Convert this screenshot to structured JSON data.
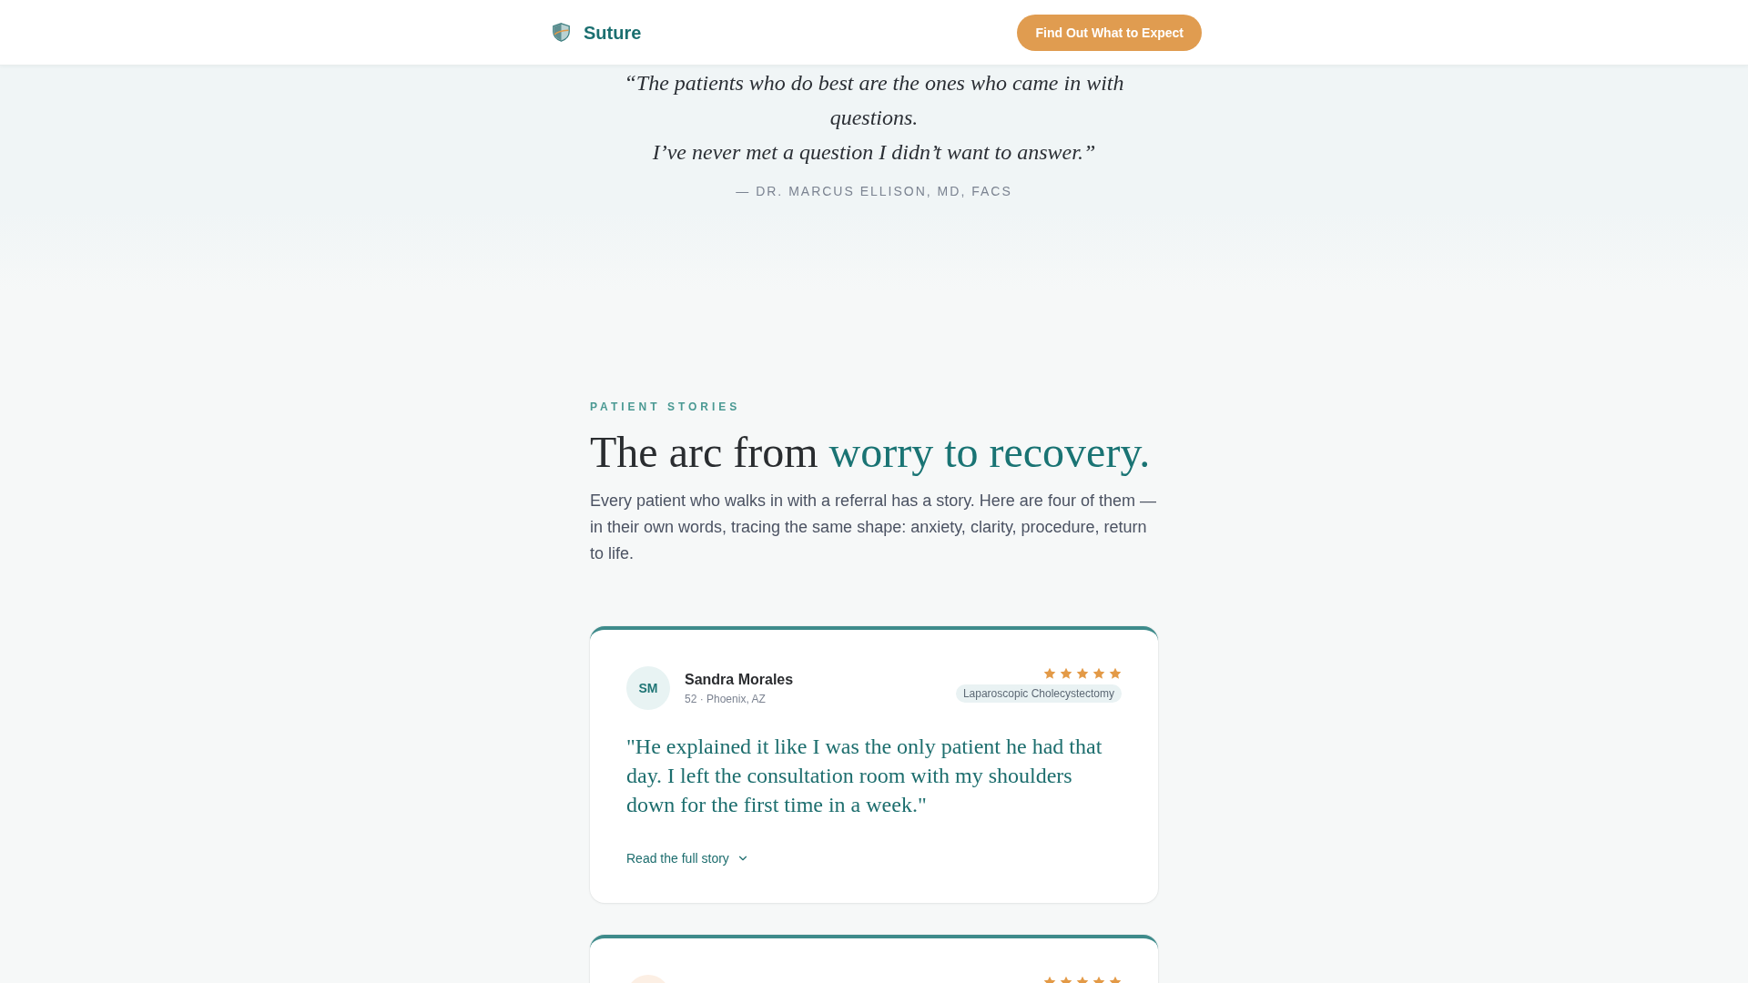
{
  "header": {
    "brand": "Suture",
    "cta": "Find Out What to Expect"
  },
  "quote": {
    "lines": [
      "“The patients who do best are the ones who came in with questions.",
      "I’ve never met a question I didn’t want to answer.”"
    ],
    "attribution": "— DR. MARCUS ELLISON, MD, FACS"
  },
  "stories_section": {
    "eyebrow": "PATIENT STORIES",
    "title": "The arc from",
    "title_accent": "worry to recovery.",
    "intro": "Every patient who walks in with a referral has a story. Here are four of them — in their own words, tracing the same shape: anxiety, clarity, procedure, return to life."
  },
  "stories": [
    {
      "initials": "SM",
      "color": "#e8f3f3",
      "name": "Sandra Morales",
      "meta": "52 · Phoenix, AZ",
      "stars": 5,
      "procedure": "Laparoscopic Cholecystectomy",
      "quote": "\"He explained it like I was the only patient he had that day. I left the consultation room with my shoulders down for the first time in a week.\"",
      "expand_label": "Read the full story",
      "expanded": false
    },
    {
      "color": "#fcefe4",
      "stars": 5
    }
  ]
}
